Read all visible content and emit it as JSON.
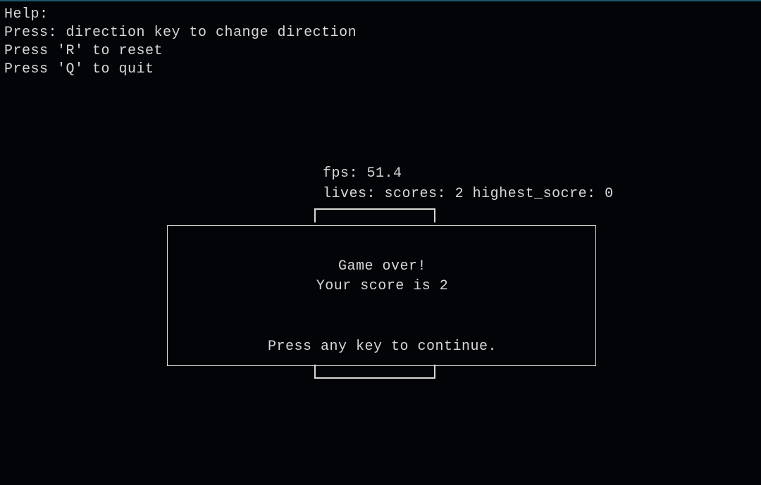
{
  "help": {
    "title": "Help:",
    "line1": "Press: direction key to change direction",
    "line2": "Press 'R' to reset",
    "line3": "Press 'Q' to quit"
  },
  "stats": {
    "fps_label": "fps:",
    "fps_value": "51.4",
    "lives_label": "lives:",
    "scores_label": "scores:",
    "scores_value": "2",
    "highest_label": "highest_socre:",
    "highest_value": "0"
  },
  "gameover": {
    "title": "Game over!",
    "score_prefix": "Your score is",
    "score_value": "2",
    "prompt": "Press any key to continue."
  }
}
